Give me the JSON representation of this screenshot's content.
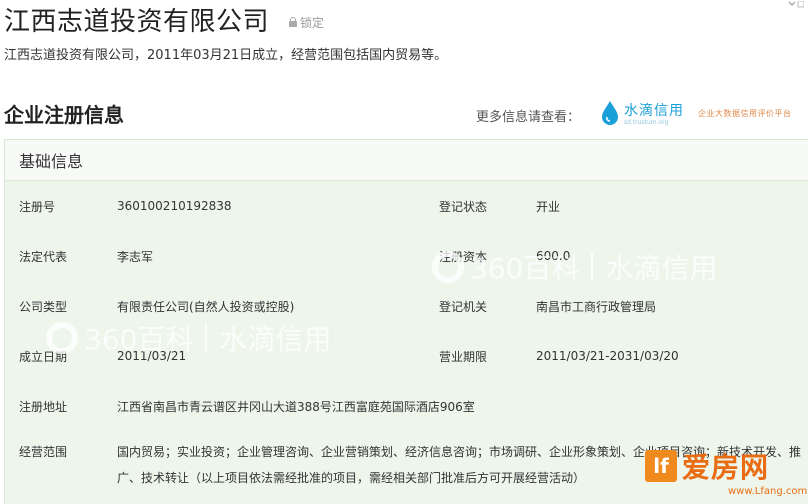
{
  "header": {
    "company_name": "江西志道投资有限公司",
    "lock_label": "锁定"
  },
  "summary": "江西志道投资有限公司，2011年03月21日成立，经营范围包括国内贸易等。",
  "section": {
    "title": "企业注册信息",
    "more_info_label": "更多信息请查看：",
    "partner_name": "水滴信用",
    "partner_url": "sd.trustum.org",
    "partner_slogan": "企业大数据信用评价平台"
  },
  "basic_info": {
    "title": "基础信息",
    "rows": [
      {
        "label1": "注册号",
        "value1": "360100210192838",
        "label2": "登记状态",
        "value2": "开业"
      },
      {
        "label1": "法定代表",
        "value1": "李志军",
        "label2": "注册资本",
        "value2": "600.0"
      },
      {
        "label1": "公司类型",
        "value1": "有限责任公司(自然人投资或控股)",
        "label2": "登记机关",
        "value2": "南昌市工商行政管理局"
      },
      {
        "label1": "成立日期",
        "value1": "2011/03/21",
        "label2": "营业期限",
        "value2": "2011/03/21-2031/03/20"
      },
      {
        "label1": "注册地址",
        "value1": "江西省南昌市青云谱区井冈山大道388号江西富庭苑国际酒店906室"
      },
      {
        "label1": "经营范围",
        "value1": "国内贸易；实业投资；企业管理咨询、企业营销策划、经济信息咨询；市场调研、企业形象策划、企业项目咨询；新技术开发、推广、技术转让（以上项目依法需经批准的项目，需经相关部门批准后方可开展经营活动）"
      }
    ]
  },
  "watermarks": {
    "text_360": "360百科",
    "text_sd": "水滴信用"
  },
  "site_logo": {
    "mark": "lf",
    "brand": "爱房网",
    "url": "www.Lfang.com"
  },
  "colors": {
    "table_bg": "#eef6ec",
    "header_bg": "#f7faf6",
    "partner_blue": "#1aa0d8",
    "site_orange": "#e96b12"
  }
}
